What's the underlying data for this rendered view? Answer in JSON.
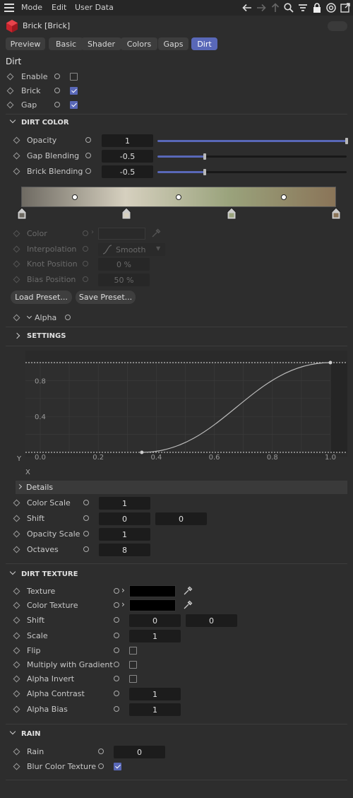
{
  "menu": {
    "mode": "Mode",
    "edit": "Edit",
    "user_data": "User Data"
  },
  "object": {
    "title": "Brick [Brick]"
  },
  "tabs": [
    {
      "label": "Preview"
    },
    {
      "label": "Basic"
    },
    {
      "label": "Shader"
    },
    {
      "label": "Colors"
    },
    {
      "label": "Gaps"
    },
    {
      "label": "Dirt"
    }
  ],
  "dirt": {
    "heading": "Dirt",
    "enable_label": "Enable",
    "brick_label": "Brick",
    "gap_label": "Gap",
    "enable": false,
    "brick": true,
    "gap": true
  },
  "dirt_color": {
    "heading": "DIRT COLOR",
    "opacity_label": "Opacity",
    "opacity": "1",
    "opacity_fraction": 1.0,
    "gap_blending_label": "Gap Blending",
    "gap_blending": "-0.5",
    "gap_blending_fraction": 0.25,
    "brick_blending_label": "Brick Blending",
    "brick_blending": "-0.5",
    "brick_blending_fraction": 0.25,
    "gradient_colors": [
      "#6e6a62",
      "#d6d0bf",
      "#9aa37c",
      "#8a7458"
    ],
    "color_label": "Color",
    "interpolation_label": "Interpolation",
    "interpolation": "Smooth",
    "knot_position_label": "Knot Position",
    "knot_position": "0 %",
    "bias_position_label": "Bias Position",
    "bias_position": "50 %",
    "load_preset": "Load Preset...",
    "save_preset": "Save Preset...",
    "alpha_label": "Alpha"
  },
  "settings": {
    "heading": "SETTINGS",
    "curve": {
      "y_axis_label": "Y",
      "x_axis_label": "X",
      "y_ticks": [
        "0.8",
        "0.4"
      ],
      "x_ticks": [
        "0.0",
        "0.2",
        "0.4",
        "0.6",
        "0.8",
        "1.0"
      ],
      "points": [
        [
          0.35,
          0.0
        ],
        [
          1.0,
          1.0
        ]
      ]
    },
    "details_label": "Details",
    "color_scale_label": "Color Scale",
    "color_scale": "1",
    "shift_label": "Shift",
    "shift_x": "0",
    "shift_y": "0",
    "opacity_scale_label": "Opacity Scale",
    "opacity_scale": "1",
    "octaves_label": "Octaves",
    "octaves": "8"
  },
  "dirt_texture": {
    "heading": "DIRT TEXTURE",
    "texture_label": "Texture",
    "color_texture_label": "Color Texture",
    "shift_label": "Shift",
    "shift_x": "0",
    "shift_y": "0",
    "scale_label": "Scale",
    "scale": "1",
    "flip_label": "Flip",
    "flip": false,
    "multiply_label": "Multiply with Gradient",
    "multiply": false,
    "alpha_invert_label": "Alpha Invert",
    "alpha_invert": false,
    "alpha_contrast_label": "Alpha Contrast",
    "alpha_contrast": "1",
    "alpha_bias_label": "Alpha Bias",
    "alpha_bias": "1"
  },
  "rain": {
    "heading": "RAIN",
    "rain_label": "Rain",
    "rain": "0",
    "blur_label": "Blur Color Texture",
    "blur": true
  },
  "colors": {
    "accent": "#5968b8",
    "bg": "#2d2d2d",
    "field": "#1c1c1c"
  }
}
